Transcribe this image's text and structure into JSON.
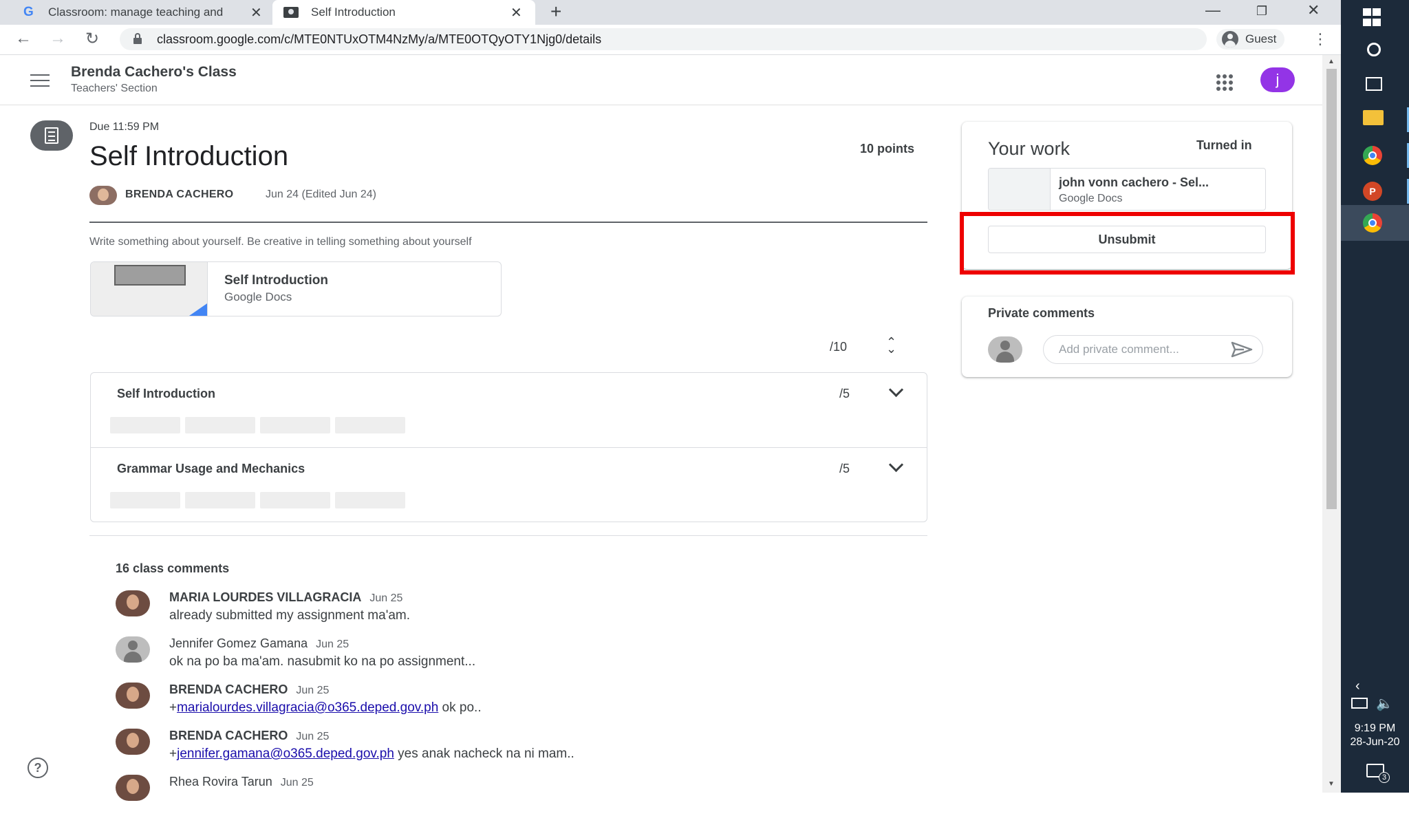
{
  "browser": {
    "tabs": [
      {
        "label": "Classroom: manage teaching and",
        "active": false
      },
      {
        "label": "Self Introduction",
        "active": true
      }
    ],
    "url": "classroom.google.com/c/MTE0NTUxOTM4NzMy/a/MTE0OTQyOTY1Njg0/details",
    "profile_label": "Guest",
    "icons": [
      "back-arrow-icon",
      "forward-arrow-icon",
      "reload-icon",
      "lock-icon",
      "menu-dots-icon",
      "new-tab-icon",
      "minimize-icon",
      "restore-icon",
      "close-icon"
    ]
  },
  "header": {
    "class_name": "Brenda Cachero's Class",
    "section": "Teachers' Section",
    "account_initial": "j",
    "account_color": "#9334e6"
  },
  "assignment": {
    "due": "Due 11:59 PM",
    "title": "Self Introduction",
    "points": "10 points",
    "teacher": "BRENDA CACHERO",
    "date": "Jun 24 (Edited Jun 24)",
    "instructions": "Write  something about yourself. Be creative in telling something about yourself",
    "attachment": {
      "title": "Self Introduction",
      "type": "Google Docs"
    },
    "grade_total": "/10"
  },
  "rubric": {
    "criteria": [
      {
        "title": "Self Introduction",
        "score": "/5"
      },
      {
        "title": "Grammar Usage and Mechanics",
        "score": "/5"
      }
    ]
  },
  "comments": {
    "count_label": "16 class comments",
    "items": [
      {
        "author": "MARIA LOURDES VILLAGRACIA",
        "date": "Jun 25",
        "body": "already submitted my assignment ma'am.",
        "avatar": "photo"
      },
      {
        "author": "Jennifer Gomez Gamana",
        "date": "Jun 25",
        "body": "ok na po ba ma'am. nasubmit ko na po assignment...",
        "avatar": "default"
      },
      {
        "author": "BRENDA CACHERO",
        "date": "Jun 25",
        "prefix": "+",
        "mention": "marialourdes.villagracia@o365.deped.gov.ph",
        "body": " ok po..",
        "avatar": "photo"
      },
      {
        "author": "BRENDA CACHERO",
        "date": "Jun 25",
        "prefix": "+",
        "mention": "jennifer.gamana@o365.deped.gov.ph",
        "body": " yes anak nacheck na ni mam..",
        "avatar": "photo"
      },
      {
        "author": "Rhea Rovira Tarun",
        "date": "Jun 25",
        "body": "",
        "avatar": "photo"
      }
    ]
  },
  "your_work": {
    "title": "Your work",
    "status": "Turned in",
    "file_name": "john vonn cachero - Sel...",
    "file_type": "Google Docs",
    "unsubmit_label": "Unsubmit",
    "highlight_color": "#ee0000"
  },
  "private_comments": {
    "title": "Private comments",
    "placeholder": "Add private comment..."
  },
  "taskbar": {
    "time": "9:19 PM",
    "date": "28-Jun-20",
    "notifications": "3",
    "apps": [
      "windows-start-icon",
      "search-icon",
      "task-view-icon",
      "file-explorer-icon",
      "chrome-icon",
      "powerpoint-icon",
      "chrome-icon"
    ]
  }
}
